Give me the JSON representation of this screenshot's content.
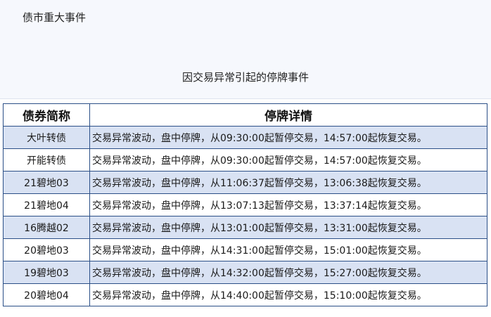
{
  "page": {
    "title": "债市重大事件"
  },
  "table": {
    "caption": "因交易异常引起的停牌事件",
    "headers": [
      "债券简称",
      "停牌详情"
    ],
    "rows": [
      {
        "bond": "大叶转债",
        "detail": "交易异常波动，盘中停牌，从09:30:00起暂停交易，14:57:00起恢复交易。"
      },
      {
        "bond": "开能转债",
        "detail": "交易异常波动，盘中停牌，从09:30:00起暂停交易，14:57:00起恢复交易。"
      },
      {
        "bond": "21碧地03",
        "detail": "交易异常波动，盘中停牌，从11:06:37起暂停交易，13:06:38起恢复交易。"
      },
      {
        "bond": "21碧地04",
        "detail": "交易异常波动，盘中停牌，从13:07:13起暂停交易，13:37:14起恢复交易。"
      },
      {
        "bond": "16腾越02",
        "detail": "交易异常波动，盘中停牌，从13:01:00起暂停交易，13:31:00起恢复交易。"
      },
      {
        "bond": "20碧地03",
        "detail": "交易异常波动，盘中停牌，从14:31:00起暂停交易，15:01:00起恢复交易。"
      },
      {
        "bond": "19碧地03",
        "detail": "交易异常波动，盘中停牌，从14:32:00起暂停交易，15:27:00起恢复交易。"
      },
      {
        "bond": "20碧地04",
        "detail": "交易异常波动，盘中停牌，从14:40:00起暂停交易，15:10:00起恢复交易。"
      }
    ]
  },
  "colors": {
    "header_border": "#2b4f87",
    "shaded_row": "#d9e2f3",
    "panel_background": "#f6f8fd"
  }
}
